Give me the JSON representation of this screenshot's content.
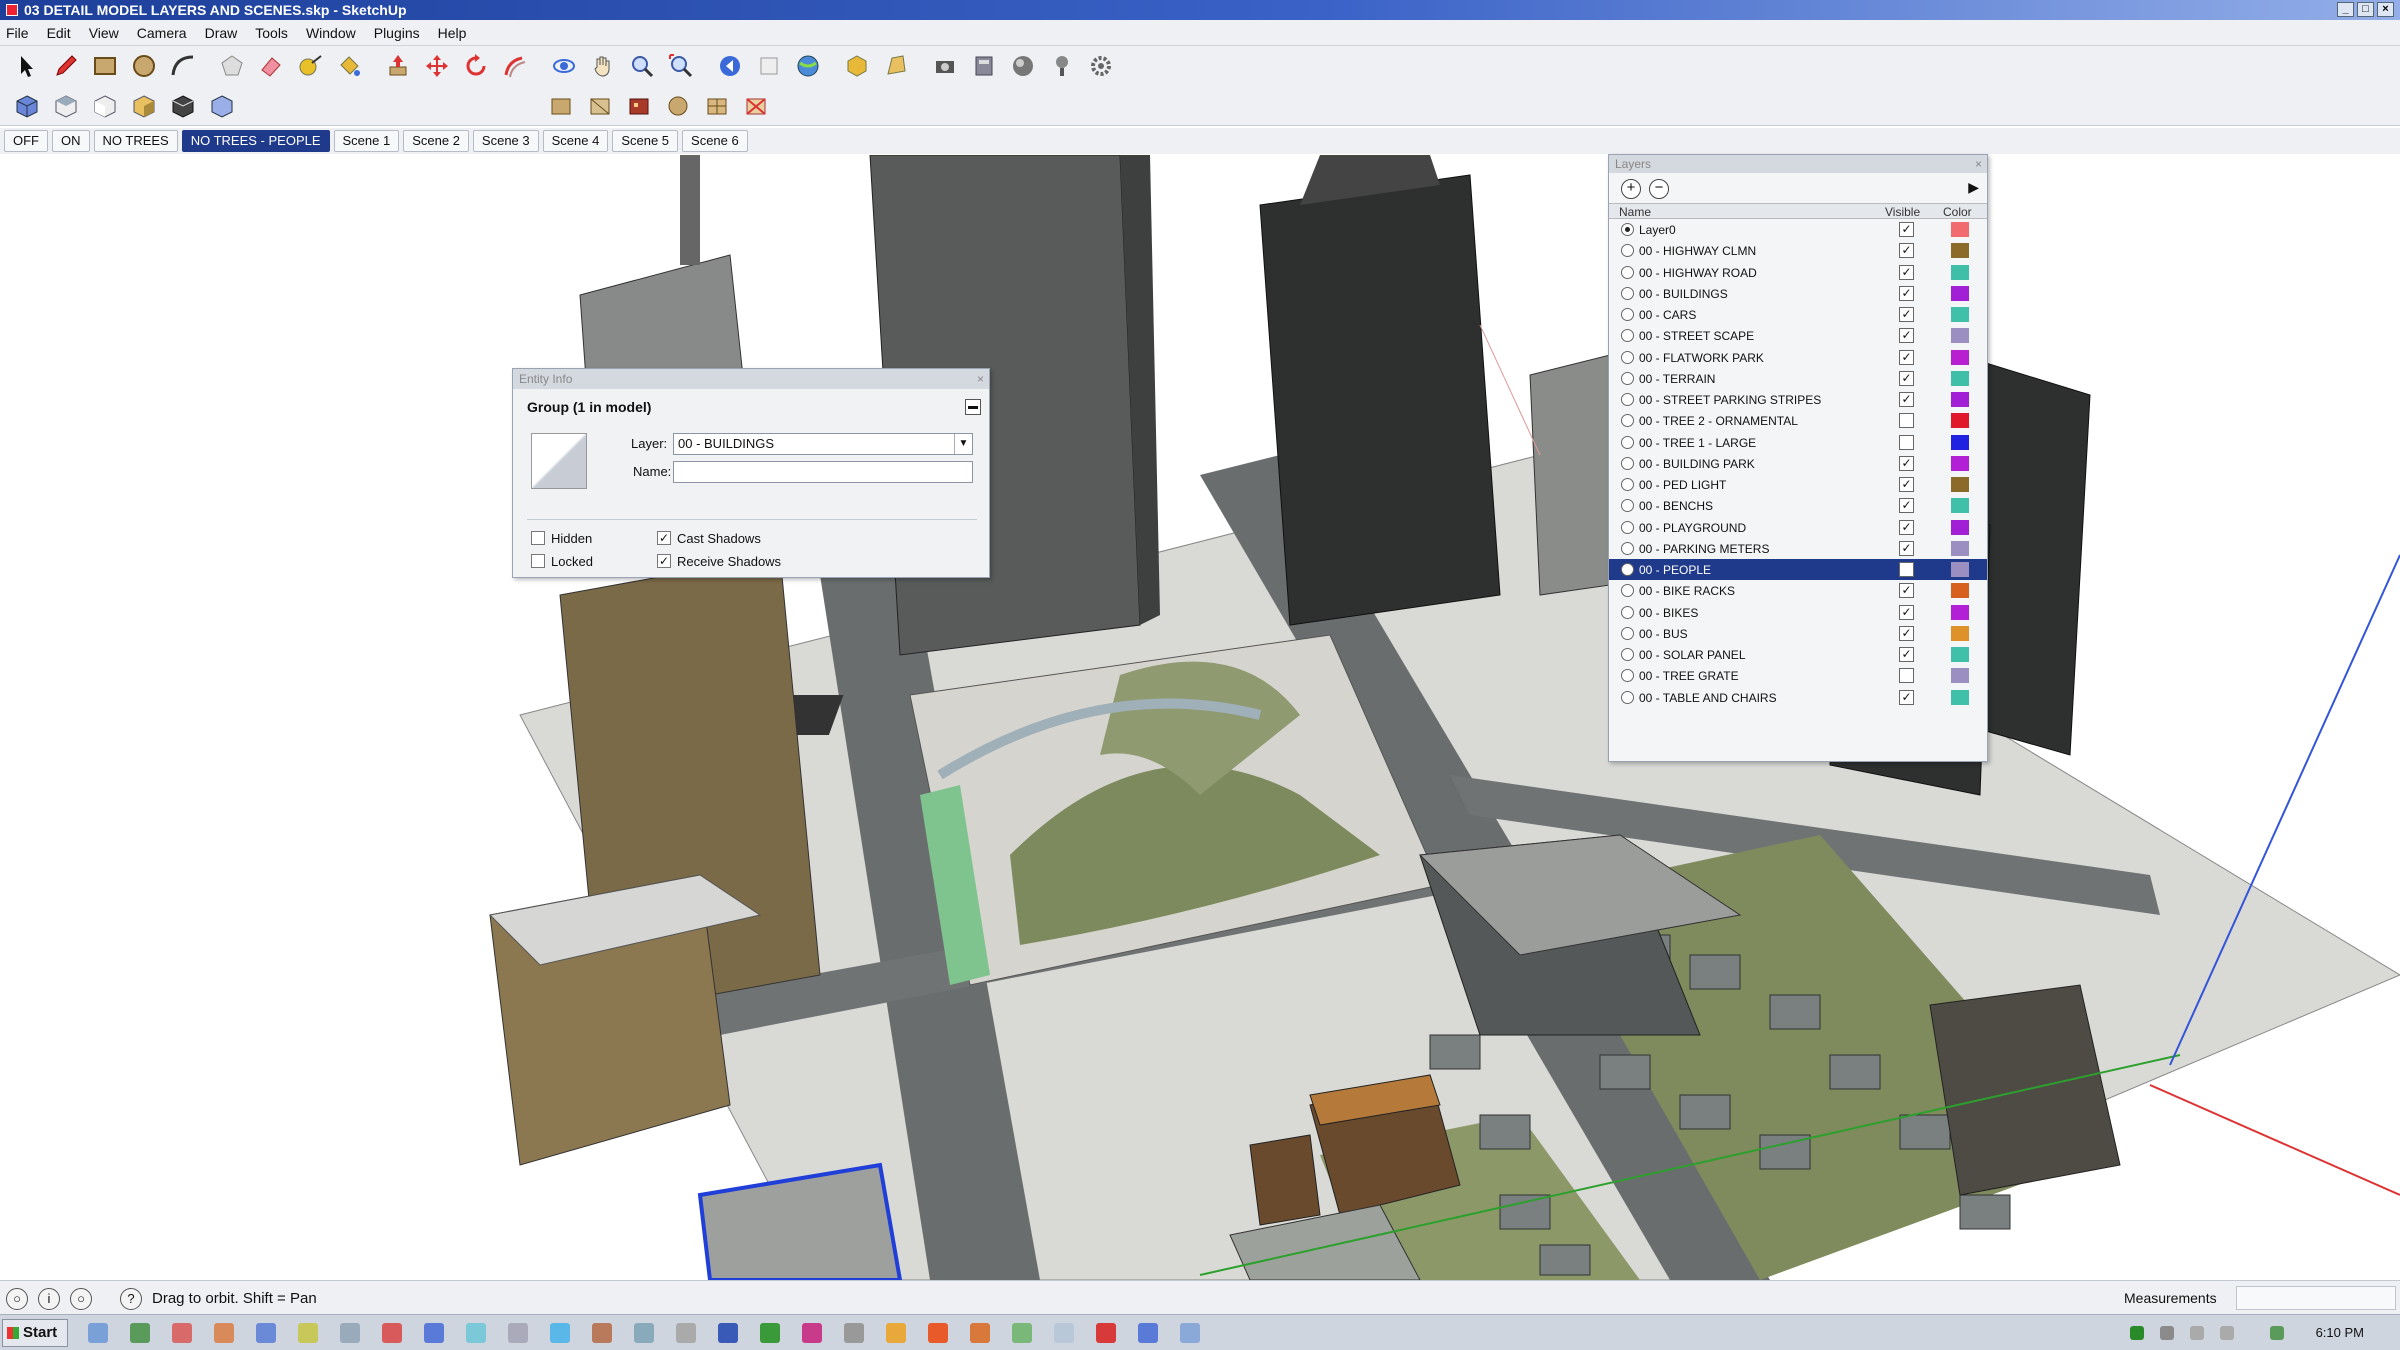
{
  "window": {
    "title": "03 DETAIL MODEL LAYERS AND SCENES.skp - SketchUp"
  },
  "menu": [
    "File",
    "Edit",
    "View",
    "Camera",
    "Draw",
    "Tools",
    "Window",
    "Plugins",
    "Help"
  ],
  "scenes": {
    "tabs": [
      "OFF",
      "ON",
      "NO TREES",
      "NO TREES - PEOPLE",
      "Scene 1",
      "Scene 2",
      "Scene 3",
      "Scene 4",
      "Scene 5",
      "Scene 6"
    ],
    "active": "NO TREES - PEOPLE"
  },
  "entity_info": {
    "title": "Entity Info",
    "group_label": "Group (1 in model)",
    "layer_label": "Layer:",
    "layer_value": "00 - BUILDINGS",
    "name_label": "Name:",
    "name_value": "",
    "hidden_label": "Hidden",
    "hidden_checked": false,
    "locked_label": "Locked",
    "locked_checked": false,
    "cast_shadows_label": "Cast Shadows",
    "cast_shadows_checked": true,
    "receive_shadows_label": "Receive Shadows",
    "receive_shadows_checked": true
  },
  "layers_panel": {
    "title": "Layers",
    "col_name": "Name",
    "col_visible": "Visible",
    "col_color": "Color",
    "layers": [
      {
        "name": "Layer0",
        "visible": true,
        "active": true,
        "color": "#f06a6e"
      },
      {
        "name": "00 - HIGHWAY CLMN",
        "visible": true,
        "color": "#8b6a2a"
      },
      {
        "name": "00 - HIGHWAY ROAD",
        "visible": true,
        "color": "#3fbfa8"
      },
      {
        "name": "00 - BUILDINGS",
        "visible": true,
        "color": "#a21fd6"
      },
      {
        "name": "00 - CARS",
        "visible": true,
        "color": "#40c0a8"
      },
      {
        "name": "00 - STREET SCAPE",
        "visible": true,
        "color": "#9a8fc0"
      },
      {
        "name": "00 - FLATWORK PARK",
        "visible": true,
        "color": "#b81fd0"
      },
      {
        "name": "00 - TERRAIN",
        "visible": true,
        "color": "#3fbfa8"
      },
      {
        "name": "00 - STREET PARKING STRIPES",
        "visible": true,
        "color": "#a21fd6"
      },
      {
        "name": "00 - TREE 2 - ORNAMENTAL",
        "visible": false,
        "color": "#e0182a"
      },
      {
        "name": "00 - TREE 1 - LARGE",
        "visible": false,
        "color": "#1f22e0"
      },
      {
        "name": "00 - BUILDING PARK",
        "visible": true,
        "color": "#b21fd6"
      },
      {
        "name": "00 - PED LIGHT",
        "visible": true,
        "color": "#8b6a2a"
      },
      {
        "name": "00 - BENCHS",
        "visible": true,
        "color": "#40c0a8"
      },
      {
        "name": "00 - PLAYGROUND",
        "visible": true,
        "color": "#a21fd6"
      },
      {
        "name": "00 - PARKING METERS",
        "visible": true,
        "color": "#9a8fc0"
      },
      {
        "name": "00 - PEOPLE",
        "visible": true,
        "selected": true,
        "color": "#9a8fc0"
      },
      {
        "name": "00 - BIKE RACKS",
        "visible": true,
        "color": "#d8601f"
      },
      {
        "name": "00 - BIKES",
        "visible": true,
        "color": "#b21fd6"
      },
      {
        "name": "00 - BUS",
        "visible": true,
        "color": "#e0922a"
      },
      {
        "name": "00 - SOLAR PANEL",
        "visible": true,
        "color": "#40c0a8"
      },
      {
        "name": "00 - TREE GRATE",
        "visible": false,
        "color": "#9a8fc0"
      },
      {
        "name": "00 - TABLE AND CHAIRS",
        "visible": true,
        "color": "#40c0a8"
      }
    ]
  },
  "statusbar": {
    "hint": "Drag to orbit.  Shift = Pan",
    "measurements_label": "Measurements",
    "measurements_value": ""
  },
  "taskbar": {
    "start_label": "Start",
    "clock": "6:10 PM"
  },
  "toolbar_icons": [
    "select-icon",
    "pencil-icon",
    "rectangle-icon",
    "circle-icon",
    "arc-icon",
    "polygon-icon",
    "eraser-icon",
    "tape-measure-icon",
    "paint-bucket-icon",
    "push-pull-icon",
    "move-icon",
    "rotate-icon",
    "follow-me-icon",
    "orbit-icon",
    "pan-icon",
    "zoom-icon",
    "zoom-extents-icon",
    "previous-view-icon",
    "next-view-icon",
    "globe-icon",
    "component-icon",
    "camera-icon",
    "section-icon",
    "material-icon",
    "shadow-icon",
    "settings-icon"
  ],
  "view_icons": [
    "iso-view-icon",
    "top-view-icon",
    "front-view-icon",
    "right-view-icon",
    "back-view-icon",
    "left-view-icon",
    "style-xray-icon",
    "style-wireframe-icon",
    "style-hidden-line-icon",
    "style-shaded-icon",
    "style-textured-icon",
    "style-monochrome-icon"
  ]
}
